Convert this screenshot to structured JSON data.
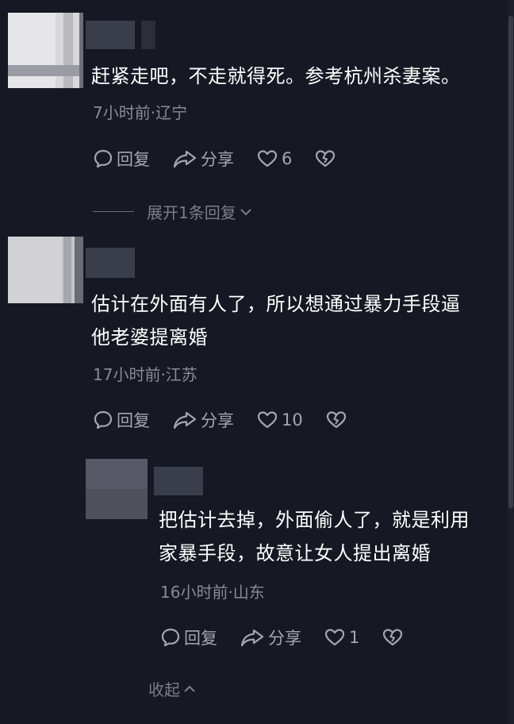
{
  "comments": [
    {
      "text_lines": [
        "赶紧走吧，不走就得死。参考杭州杀妻案。"
      ],
      "meta": "7小时前·辽宁",
      "reply_label": "回复",
      "share_label": "分享",
      "like_count": "6"
    },
    {
      "text_lines": [
        "估计在外面有人了，所以想通过暴力手段逼",
        "他老婆提离婚"
      ],
      "meta": "17小时前·江苏",
      "reply_label": "回复",
      "share_label": "分享",
      "like_count": "10"
    },
    {
      "text_lines": [
        "把估计去掉，外面偷人了，就是利用",
        "家暴手段，故意让女人提出离婚"
      ],
      "meta": "16小时前·山东",
      "reply_label": "回复",
      "share_label": "分享",
      "like_count": "1"
    }
  ],
  "expand_replies_label": "展开1条回复",
  "collapse_label": "收起",
  "colors": {
    "background": "#161823",
    "text": "#ffffff",
    "meta": "#8a8b93",
    "action": "#a5a6ad"
  }
}
